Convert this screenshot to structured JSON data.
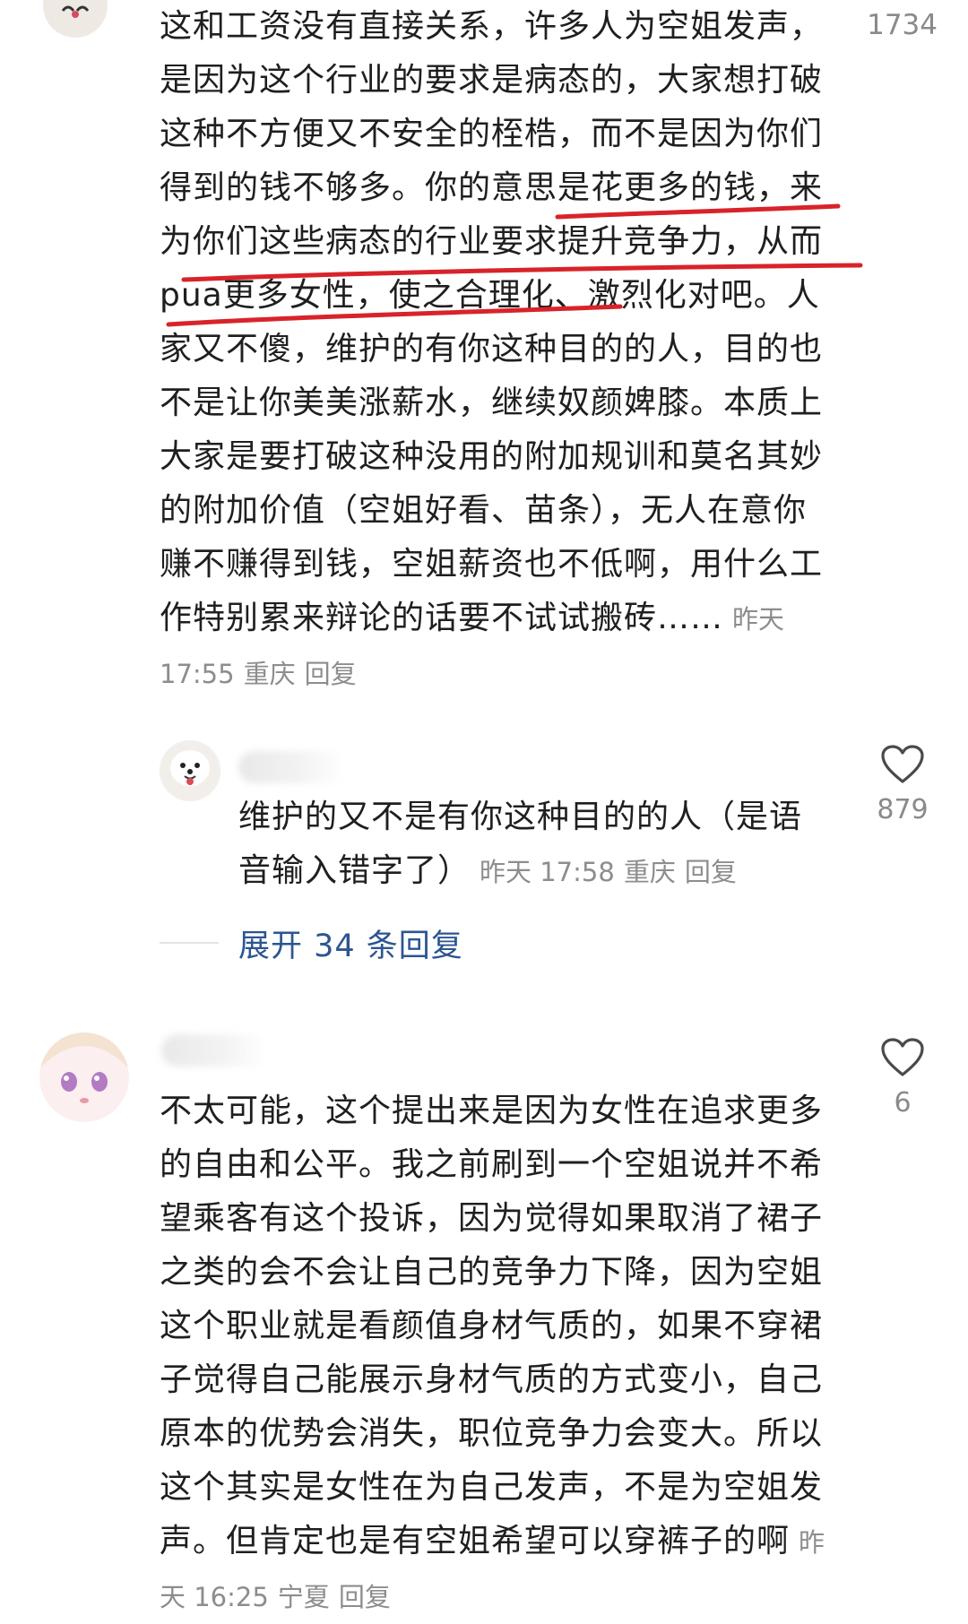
{
  "comment1": {
    "text": "这和工资没有直接关系，许多人为空姐发声，是因为这个行业的要求是病态的，大家想打破这种不方便又不安全的桎梏，而不是因为你们得到的钱不够多。你的意思是花更多的钱，来为你们这些病态的行业要求提升竞争力，从而pua更多女性，使之合理化、激烈化对吧。人家又不傻，维护的有你这种目的的人，目的也不是让你美美涨薪水，继续奴颜婢膝。本质上大家是要打破这种没用的附加规训和莫名其妙的附加价值（空姐好看、苗条），无人在意你赚不赚得到钱，空姐薪资也不低啊，用什么工作特别累来辩论的话要不试试搬砖……",
    "time": "昨天 17:55",
    "location": "重庆",
    "reply_label": "回复",
    "like_count": "1734"
  },
  "reply1": {
    "text": "维护的又不是有你这种目的的人（是语音输入错字了）",
    "time": "昨天 17:58",
    "location": "重庆",
    "reply_label": "回复",
    "like_count": "879"
  },
  "expand": {
    "label": "展开 34 条回复"
  },
  "comment2": {
    "text": "不太可能，这个提出来是因为女性在追求更多的自由和公平。我之前刷到一个空姐说并不希望乘客有这个投诉，因为觉得如果取消了裙子之类的会不会让自己的竞争力下降，因为空姐这个职业就是看颜值身材气质的，如果不穿裙子觉得自己能展示身材气质的方式变小，自己原本的优势会消失，职位竞争力会变大。所以这个其实是女性在为自己发声，不是为空姐发声。但肯定也是有空姐希望可以穿裤子的啊",
    "time": "昨天 16:25",
    "location": "宁夏",
    "reply_label": "回复",
    "like_count": "6"
  },
  "colors": {
    "text": "#1f1f1f",
    "meta": "#8d8d8d",
    "link": "#2c5591",
    "annotation": "#d8232a"
  },
  "icons": {
    "like": "heart-outline-icon"
  }
}
